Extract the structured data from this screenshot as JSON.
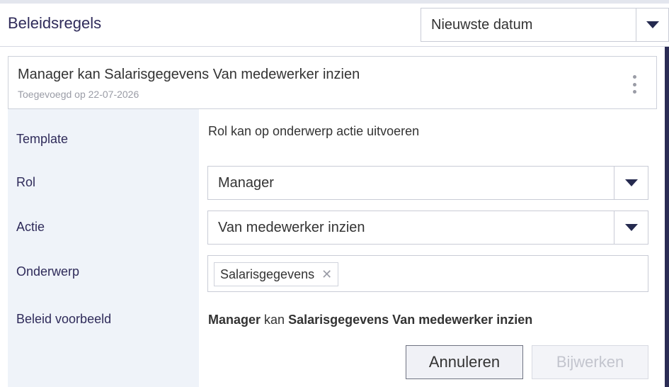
{
  "header": {
    "title": "Beleidsregels",
    "sort": {
      "selected": "Nieuwste datum"
    }
  },
  "policy": {
    "title": "Manager kan Salarisgegevens Van medewerker inzien",
    "added": "Toegevoegd op 22-07-2026"
  },
  "form": {
    "labels": {
      "template": "Template",
      "role": "Rol",
      "action": "Actie",
      "subject": "Onderwerp",
      "example": "Beleid voorbeeld"
    },
    "template_value": "Rol kan op onderwerp actie uitvoeren",
    "role_value": "Manager",
    "action_value": "Van medewerker inzien",
    "subject_tags": [
      "Salarisgegevens"
    ],
    "example": {
      "role": "Manager",
      "connector": "kan",
      "rest": "Salarisgegevens Van medewerker inzien"
    }
  },
  "buttons": {
    "cancel": "Annuleren",
    "update": "Bijwerken"
  },
  "icons": {
    "dropdown": "chevron-down-icon",
    "menu": "kebab-menu-icon",
    "remove_tag": "close-icon"
  },
  "colors": {
    "heading": "#2f2b5a",
    "label_bg": "#eff3f9",
    "accent_dark": "#2c2d55"
  }
}
